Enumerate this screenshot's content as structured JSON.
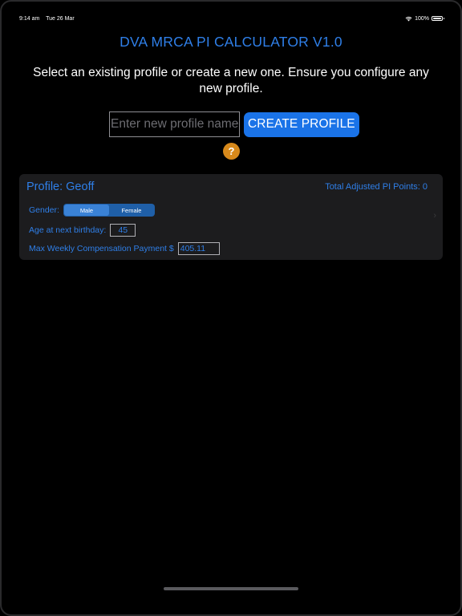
{
  "status_bar": {
    "time": "9:14 am",
    "date": "Tue 26 Mar",
    "battery": "100%"
  },
  "app": {
    "title": "DVA MRCA PI CALCULATOR V1.0",
    "instructions": "Select an existing profile or create a new one. Ensure you configure any new profile."
  },
  "new_profile": {
    "placeholder": "Enter new profile name",
    "value": "",
    "create_label": "CREATE PROFILE",
    "help_label": "?"
  },
  "profile_card": {
    "title": "Profile: Geoff",
    "total_points": "Total Adjusted PI Points: 0",
    "gender_label": "Gender:",
    "gender_options": [
      "Male",
      "Female"
    ],
    "gender_selected": "Male",
    "age_label": "Age at next birthday:",
    "age_value": "45",
    "payment_label": "Max Weekly Compensation Payment $",
    "payment_value": "405.11",
    "chevron": "›"
  },
  "colors": {
    "accent": "#2f7fe8",
    "button": "#1a73e8",
    "help": "#d7891b",
    "card": "#1c1c1e"
  },
  "icons": {
    "wifi": "wifi-icon",
    "battery": "battery-icon",
    "help": "question-mark-icon",
    "chevron": "chevron-right-icon"
  }
}
